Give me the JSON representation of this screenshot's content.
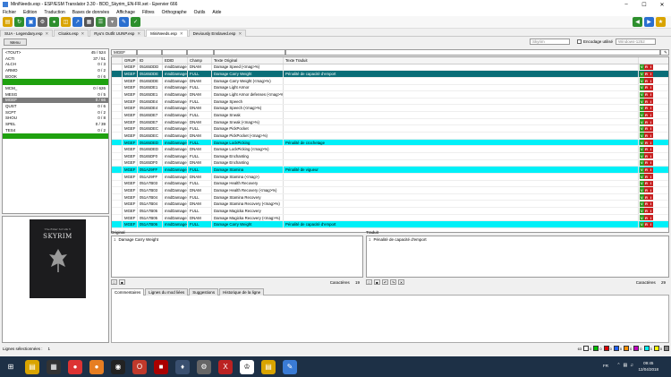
{
  "window": {
    "title": "MiniNeeds.esp - ESP/ESM Translator 3.30 - BDD_Skyrim_EN-FR.xet - Epervier 666"
  },
  "menu": [
    "Fichier",
    "Edition",
    "Traduction",
    "Bases de données",
    "Affichage",
    "Filtres",
    "Orthographe",
    "Outils",
    "Aide"
  ],
  "tabs": [
    {
      "label": "SUA - Legendary.esp",
      "active": false
    },
    {
      "label": "Cloaks.esp",
      "active": false
    },
    {
      "label": "Ryu's Outfit UUNP.esp",
      "active": false
    },
    {
      "label": "MiniNeeds.esp",
      "active": true
    },
    {
      "label": "Deviously Enslaved.esp",
      "active": false
    }
  ],
  "left": {
    "menu_button": "Menu",
    "records": [
      {
        "name": "<TOUT>",
        "count": "45 / 524",
        "state": ""
      },
      {
        "name": "ACTI",
        "count": "37 / 51",
        "state": ""
      },
      {
        "name": "ALCH",
        "count": "0 / 3",
        "state": ""
      },
      {
        "name": "ARMO",
        "count": "0 / 2",
        "state": ""
      },
      {
        "name": "BOOK",
        "count": "0 / 6",
        "state": ""
      },
      {
        "name": "",
        "count": "",
        "state": "green"
      },
      {
        "name": "MCM_",
        "count": "0 / 626",
        "state": ""
      },
      {
        "name": "MESG",
        "count": "0 / 5",
        "state": ""
      },
      {
        "name": "MGEF",
        "count": "0 / 66",
        "state": "sel"
      },
      {
        "name": "QUST",
        "count": "0 / 6",
        "state": ""
      },
      {
        "name": "SCPT",
        "count": "0 / 2",
        "state": ""
      },
      {
        "name": "SHOU",
        "count": "0 / 8",
        "state": ""
      },
      {
        "name": "SPEL",
        "count": "0 / 39",
        "state": ""
      },
      {
        "name": "TES4",
        "count": "0 / 2",
        "state": ""
      },
      {
        "name": "",
        "count": "",
        "state": "green"
      }
    ],
    "cover": {
      "subtitle": "The Elder Scrolls V",
      "title": "SKYRIM"
    }
  },
  "right": {
    "game_select": "Skyrim",
    "encoding_label": "Encodage utilisé",
    "encoding_select": "Windows-1252",
    "filter_first": "MGEF",
    "columns": [
      "GRUP",
      "ID",
      "EDID",
      "Champ",
      "Texte Original",
      "Texte Traduit"
    ],
    "rows": [
      {
        "grup": "MGEF",
        "id": "05165DDD",
        "edid": "mndDamageSpe...",
        "champ": "DNAM",
        "orig": "Damage Speed (<mag>%)",
        "trad": "",
        "hl": ""
      },
      {
        "grup": "MGEF",
        "id": "05165DDE",
        "edid": "mndDamageCar...",
        "champ": "FULL",
        "orig": "Damage Carry Weight",
        "trad": "Pénalité de capacité d'emport",
        "hl": "hl2"
      },
      {
        "grup": "MGEF",
        "id": "05165DDE",
        "edid": "mndDamageCar...",
        "champ": "DNAM",
        "orig": "Damage Carry Weight (<mag>%)",
        "trad": "",
        "hl": ""
      },
      {
        "grup": "MGEF",
        "id": "05165DE1",
        "edid": "mndDamageLight...",
        "champ": "FULL",
        "orig": "Damage Light Armor",
        "trad": "",
        "hl": ""
      },
      {
        "grup": "MGEF",
        "id": "05165DE1",
        "edid": "mndDamageLight...",
        "champ": "DNAM",
        "orig": "Damage Light Armor defenses (<mag>%)",
        "trad": "",
        "hl": ""
      },
      {
        "grup": "MGEF",
        "id": "05165DE4",
        "edid": "mndDamageSpe...",
        "champ": "FULL",
        "orig": "Damage Speech",
        "trad": "",
        "hl": ""
      },
      {
        "grup": "MGEF",
        "id": "05165DE4",
        "edid": "mndDamageSpe...",
        "champ": "DNAM",
        "orig": "Damage Speech (<mag>%)",
        "trad": "",
        "hl": ""
      },
      {
        "grup": "MGEF",
        "id": "05165DE7",
        "edid": "mndDamageSne...",
        "champ": "FULL",
        "orig": "Damage Sneak",
        "trad": "",
        "hl": ""
      },
      {
        "grup": "MGEF",
        "id": "05165DE7",
        "edid": "mndDamageSne...",
        "champ": "DNAM",
        "orig": "Damage Sneak (<mag>%)",
        "trad": "",
        "hl": ""
      },
      {
        "grup": "MGEF",
        "id": "05165DEC",
        "edid": "mndDamagePick...",
        "champ": "FULL",
        "orig": "Damage PickPocket",
        "trad": "",
        "hl": ""
      },
      {
        "grup": "MGEF",
        "id": "05165DEC",
        "edid": "mndDamagePick...",
        "champ": "DNAM",
        "orig": "Damage PickPocket (<mag>%)",
        "trad": "",
        "hl": ""
      },
      {
        "grup": "MGEF",
        "id": "05165DED",
        "edid": "mndDamageLoc...",
        "champ": "FULL",
        "orig": "Damage LockPicking",
        "trad": "Pénalité de crochetage",
        "hl": "hl"
      },
      {
        "grup": "MGEF",
        "id": "05165DED",
        "edid": "mndDamageLoc...",
        "champ": "DNAM",
        "orig": "Damage LockPicking (<mag>%)",
        "trad": "",
        "hl": ""
      },
      {
        "grup": "MGEF",
        "id": "05165DF0",
        "edid": "mndDamageEnc...",
        "champ": "FULL",
        "orig": "Damage Enchanting",
        "trad": "",
        "hl": ""
      },
      {
        "grup": "MGEF",
        "id": "05165DF0",
        "edid": "mndDamageEnc...",
        "champ": "DNAM",
        "orig": "Damage Enchanting",
        "trad": "",
        "hl": ""
      },
      {
        "grup": "MGEF",
        "id": "051A29FF",
        "edid": "mndDamageSta...",
        "champ": "FULL",
        "orig": "Damage Stamina",
        "trad": "Pénalité de vigueur",
        "hl": "hl"
      },
      {
        "grup": "MGEF",
        "id": "051A29FF",
        "edid": "mndDamageSta...",
        "champ": "DNAM",
        "orig": "Damage Stamina (<mag>)",
        "trad": "",
        "hl": ""
      },
      {
        "grup": "MGEF",
        "id": "051A7B03",
        "edid": "mndDamageHeal...",
        "champ": "FULL",
        "orig": "Damage Health Recovery",
        "trad": "",
        "hl": ""
      },
      {
        "grup": "MGEF",
        "id": "051A7B03",
        "edid": "mndDamageHeal...",
        "champ": "DNAM",
        "orig": "Damage Health Recovery (<mag>%)",
        "trad": "",
        "hl": ""
      },
      {
        "grup": "MGEF",
        "id": "051A7B04",
        "edid": "mndDamageSta...",
        "champ": "FULL",
        "orig": "Damage Stamina Recovery",
        "trad": "",
        "hl": ""
      },
      {
        "grup": "MGEF",
        "id": "051A7B04",
        "edid": "mndDamageSta...",
        "champ": "DNAM",
        "orig": "Damage Stamina Recovery (<mag>%)",
        "trad": "",
        "hl": ""
      },
      {
        "grup": "MGEF",
        "id": "051A7B05",
        "edid": "mndDamageMag...",
        "champ": "FULL",
        "orig": "Damage Magicka Recovery",
        "trad": "",
        "hl": ""
      },
      {
        "grup": "MGEF",
        "id": "051A7B05",
        "edid": "mndDamageMag...",
        "champ": "DNAM",
        "orig": "Damage Magicka Recovery (<mag>%)",
        "trad": "",
        "hl": ""
      },
      {
        "grup": "MGEF",
        "id": "051A7B06",
        "edid": "mndDamageCar...",
        "champ": "FULL",
        "orig": "Damage Carry Weight",
        "trad": "Pénalité de capacité d'emport",
        "hl": "hl"
      }
    ],
    "vri": {
      "v": "V",
      "r": "R",
      "i": "I"
    },
    "original": {
      "label": "Original",
      "line": "1",
      "text": "Damage Carry Weight",
      "count_label": "Caractères",
      "count": "19"
    },
    "traduit": {
      "label": "Traduit",
      "line": "1",
      "text": "Pénalité de capacité d'emport",
      "count_label": "Caractères",
      "count": "29"
    },
    "bottom_tabs": [
      {
        "label": "Commentaires",
        "active": true
      },
      {
        "label": "Lignes du mod liées",
        "active": false
      },
      {
        "label": "Suggestions",
        "active": false
      },
      {
        "label": "Historique de la ligne",
        "active": false
      }
    ]
  },
  "status": {
    "label": "Lignes sélectionnées :",
    "value": "1",
    "legend": [
      {
        "color": "#ffffff",
        "num": "63"
      },
      {
        "color": "#00c000",
        "num": "0"
      },
      {
        "color": "#e00000",
        "num": "0"
      },
      {
        "color": "#2060ff",
        "num": "0"
      },
      {
        "color": "#ff9000",
        "num": "0"
      },
      {
        "color": "#c000c0",
        "num": "0"
      },
      {
        "color": "#00f0f8",
        "num": "0"
      },
      {
        "color": "#ffff00",
        "num": "3"
      },
      {
        "color": "#888888",
        "num": "0"
      }
    ]
  },
  "taskbar": {
    "lang": "FR",
    "time": "09:45",
    "date": "12/04/2018"
  }
}
